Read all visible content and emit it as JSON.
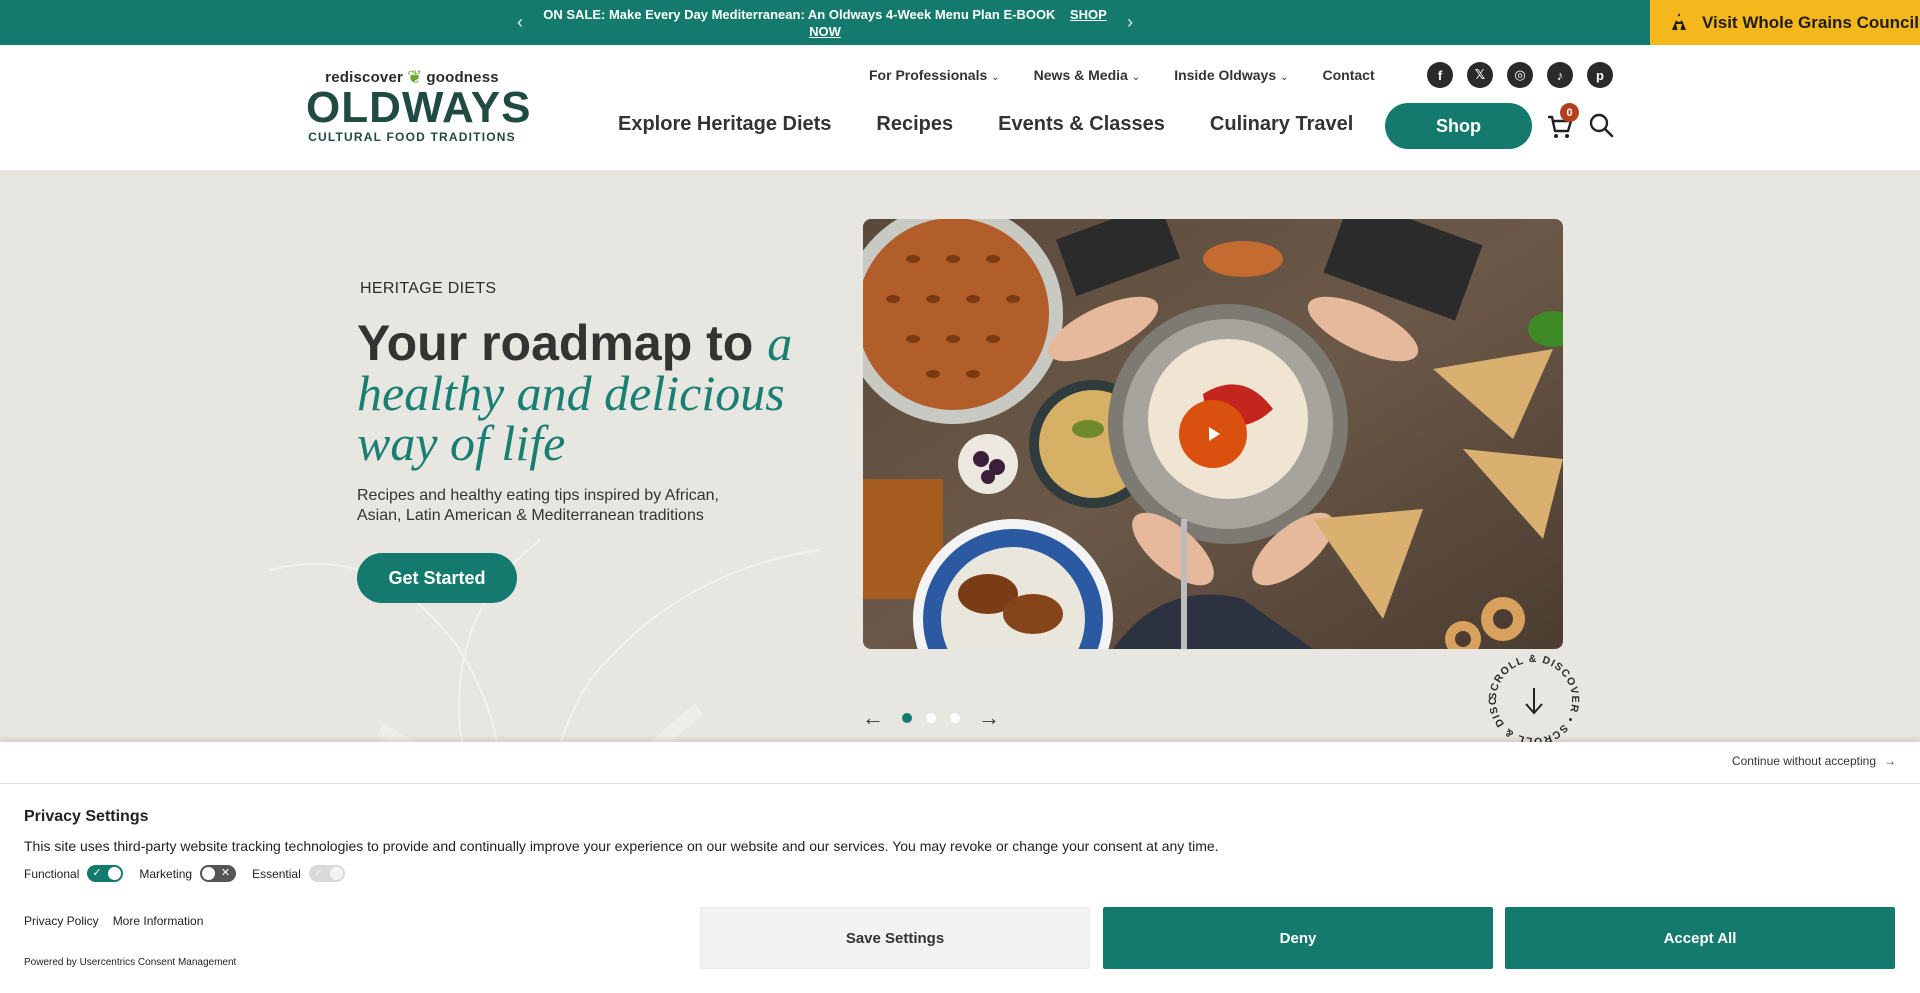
{
  "announcement": {
    "text": "ON SALE: Make Every Day Mediterranean: An Oldways 4-Week Menu Plan E-BOOK",
    "link_text": "SHOP NOW",
    "prev_icon": "chevron-left-icon",
    "next_icon": "chevron-right-icon",
    "whole_grains_label": "Visit Whole Grains Council"
  },
  "logo": {
    "tagline": "rediscover goodness",
    "name": "OLDWAYS",
    "subtitle": "CULTURAL FOOD TRADITIONS"
  },
  "utility_nav": [
    {
      "label": "For Professionals",
      "has_dropdown": true
    },
    {
      "label": "News & Media",
      "has_dropdown": true
    },
    {
      "label": "Inside Oldways",
      "has_dropdown": true
    },
    {
      "label": "Contact",
      "has_dropdown": false
    }
  ],
  "social": [
    "facebook-icon",
    "x-twitter-icon",
    "instagram-icon",
    "tiktok-icon",
    "pinterest-icon"
  ],
  "main_nav": [
    "Explore Heritage Diets",
    "Recipes",
    "Events & Classes",
    "Culinary Travel"
  ],
  "shop_label": "Shop",
  "cart_count": "0",
  "hero": {
    "eyebrow": "HERITAGE DIETS",
    "title_plain": "Your roadmap to ",
    "title_italic": "a healthy and delicious way of life",
    "description": "Recipes and healthy eating tips inspired by African, Asian, Latin American & Mediterranean traditions",
    "cta": "Get Started",
    "slide_count": 3,
    "active_slide": 1,
    "scroll_badge": "SCROLL & DISCOVER • SCROLL & DISCOVER •"
  },
  "consent": {
    "continue_label": "Continue without accepting",
    "title": "Privacy Settings",
    "text": "This site uses third-party website tracking technologies to provide and continually improve your experience on our website and our services. You may revoke or change your consent at any time.",
    "toggles": [
      {
        "label": "Functional",
        "state": "on"
      },
      {
        "label": "Marketing",
        "state": "off"
      },
      {
        "label": "Essential",
        "state": "disabled"
      }
    ],
    "links": [
      "Privacy Policy",
      "More Information"
    ],
    "powered_by": "Powered by Usercentrics Consent Management",
    "save_label": "Save Settings",
    "deny_label": "Deny",
    "accept_label": "Accept All"
  },
  "colors": {
    "brand_teal": "#137a6d",
    "accent_yellow": "#f5b81c",
    "play_orange": "#d9500f",
    "badge_red": "#b5401d"
  }
}
